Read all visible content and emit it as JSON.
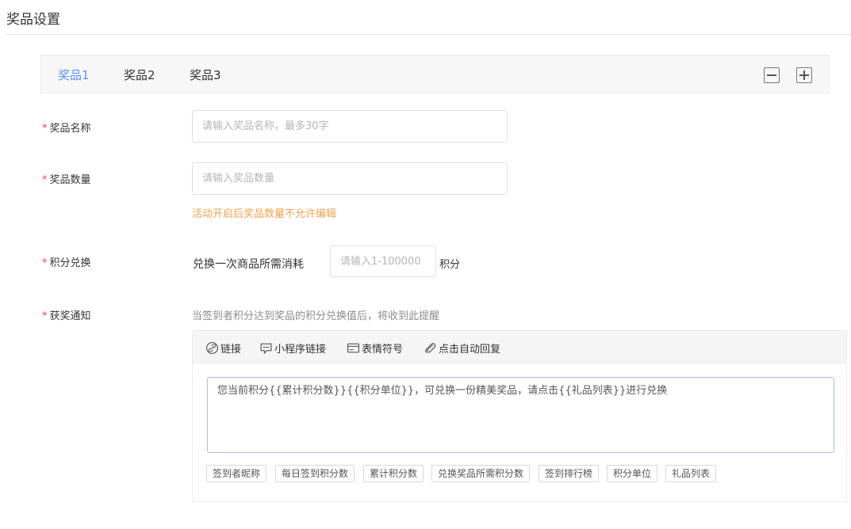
{
  "page": {
    "title": "奖品设置"
  },
  "tabs": [
    {
      "label": "奖品1",
      "active": true
    },
    {
      "label": "奖品2",
      "active": false
    },
    {
      "label": "奖品3",
      "active": false
    }
  ],
  "tab_controls": {
    "remove_icon": "minus-square-icon",
    "add_icon": "plus-square-icon"
  },
  "form": {
    "required_mark": "*",
    "prize_name": {
      "label": "奖品名称",
      "placeholder": "请输入奖品名称，最多30字",
      "value": ""
    },
    "prize_quantity": {
      "label": "奖品数量",
      "placeholder": "请输入奖品数量",
      "value": "",
      "hint": "活动开启后奖品数量不允许编辑"
    },
    "points_exchange": {
      "label": "积分兑换",
      "prefix": "兑换一次商品所需消耗",
      "placeholder": "请输入1-100000",
      "value": "",
      "suffix": "积分"
    },
    "notification": {
      "label": "获奖通知",
      "description": "当签到者积分达到奖品的积分兑换值后，将收到此提醒",
      "toolbar": [
        {
          "label": "链接",
          "icon": "link-icon"
        },
        {
          "label": "小程序链接",
          "icon": "mini-program-icon"
        },
        {
          "label": "表情符号",
          "icon": "emoji-icon"
        },
        {
          "label": "点击自动回复",
          "icon": "paperclip-icon"
        }
      ],
      "content": "您当前积分{{累计积分数}}{{积分单位}}，可兑换一份精美奖品，请点击{{礼品列表}}进行兑换",
      "variables": [
        "签到者昵称",
        "每日签到积分数",
        "累计积分数",
        "兑换奖品所需积分数",
        "签到排行榜",
        "积分单位",
        "礼品列表"
      ]
    }
  },
  "colors": {
    "accent": "#5b8ff9",
    "required": "#ee4444",
    "warning": "#f5a14c",
    "border": "#dcdfe6",
    "textarea_border": "#aab8e8"
  }
}
